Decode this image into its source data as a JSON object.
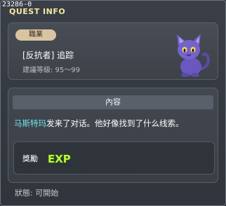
{
  "quest_id": "23286-0",
  "window_title": "QUEST INFO",
  "job_panel": {
    "badge": "職業",
    "job_name": "[反抗者] 追踪",
    "level_range": "建議等級: 95～99"
  },
  "content_panel": {
    "header": "內容",
    "npc_name": "马斯特玛",
    "message": "发来了对话。他好像找到了什么线索。",
    "reward_label": "獎勵",
    "reward_icon_text": "EXP"
  },
  "status": "狀態:  可開始",
  "colors": {
    "title": "#f2e9a0",
    "npc": "#6fe2e6",
    "badge_bg": "#d9c4a2",
    "exp": "#b8f53a"
  },
  "icons": {
    "npc_portrait": "purple-cat-icon",
    "reward": "exp-icon"
  }
}
